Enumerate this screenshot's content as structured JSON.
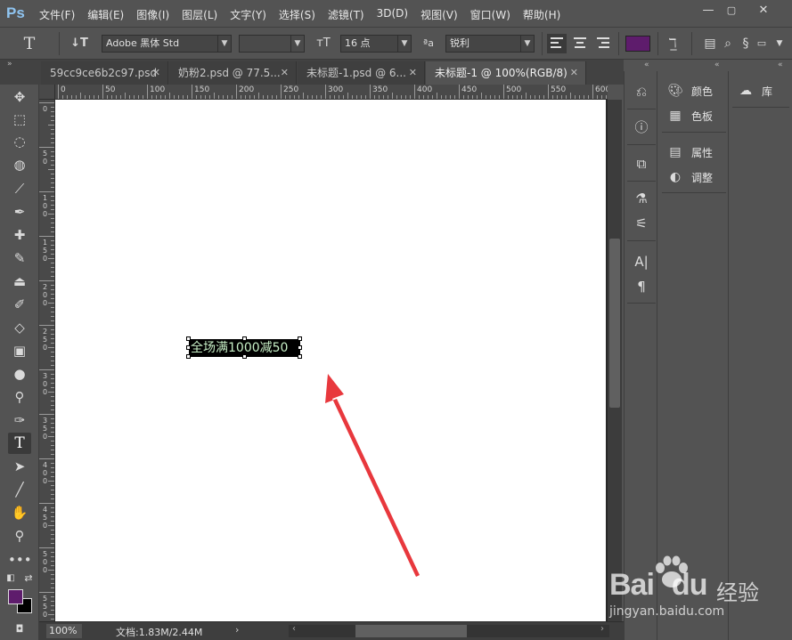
{
  "app": {
    "logo": "Ps"
  },
  "menu": [
    "文件(F)",
    "编辑(E)",
    "图像(I)",
    "图层(L)",
    "文字(Y)",
    "选择(S)",
    "滤镜(T)",
    "3D(D)",
    "视图(V)",
    "窗口(W)",
    "帮助(H)"
  ],
  "window_controls": {
    "minimize": "—",
    "maximize": "▢",
    "close": "✕"
  },
  "options": {
    "font_family": "Adobe 黑体 Std",
    "font_style": "",
    "font_size": "16 点",
    "antialias": "锐利",
    "text_color": "#5e1c6c"
  },
  "tabs": [
    {
      "label": "59cc9ce6b2c97.psd",
      "active": false
    },
    {
      "label": "奶粉2.psd @ 77.5...",
      "active": false
    },
    {
      "label": "未标题-1.psd @ 6...",
      "active": false
    },
    {
      "label": "未标题-1 @ 100%(RGB/8)",
      "active": true
    }
  ],
  "tab_close": "✕",
  "ruler": {
    "h_labels": [
      "0",
      "50",
      "100",
      "150",
      "200",
      "250",
      "300",
      "350",
      "400",
      "450",
      "500",
      "550",
      "600"
    ],
    "v_labels": [
      "0",
      "50",
      "100",
      "150",
      "200",
      "250",
      "300",
      "350",
      "400",
      "450",
      "500",
      "550"
    ]
  },
  "canvas": {
    "text_layer": "全场满1000减50",
    "text_color": "#c7efc6",
    "background": "#ffffff"
  },
  "status": {
    "zoom": "100%",
    "doc_info": "文档:1.83M/2.44M",
    "arrow": "›"
  },
  "panels": {
    "group1": [
      {
        "label": "颜色",
        "icon": "palette-icon"
      },
      {
        "label": "色板",
        "icon": "swatches-grid-icon"
      },
      {
        "label": "属性",
        "icon": "properties-icon"
      },
      {
        "label": "调整",
        "icon": "adjustments-icon"
      }
    ],
    "group2": [
      {
        "label": "库",
        "icon": "creative-cloud-icon"
      }
    ]
  },
  "colors": {
    "foreground": "#5e1c6c",
    "background": "#000000",
    "annotation_arrow": "#e8383d"
  },
  "watermark": {
    "brand": "Bai",
    "brand_du": "du",
    "brand_cn": "经验",
    "url": "jingyan.baidu.com"
  }
}
